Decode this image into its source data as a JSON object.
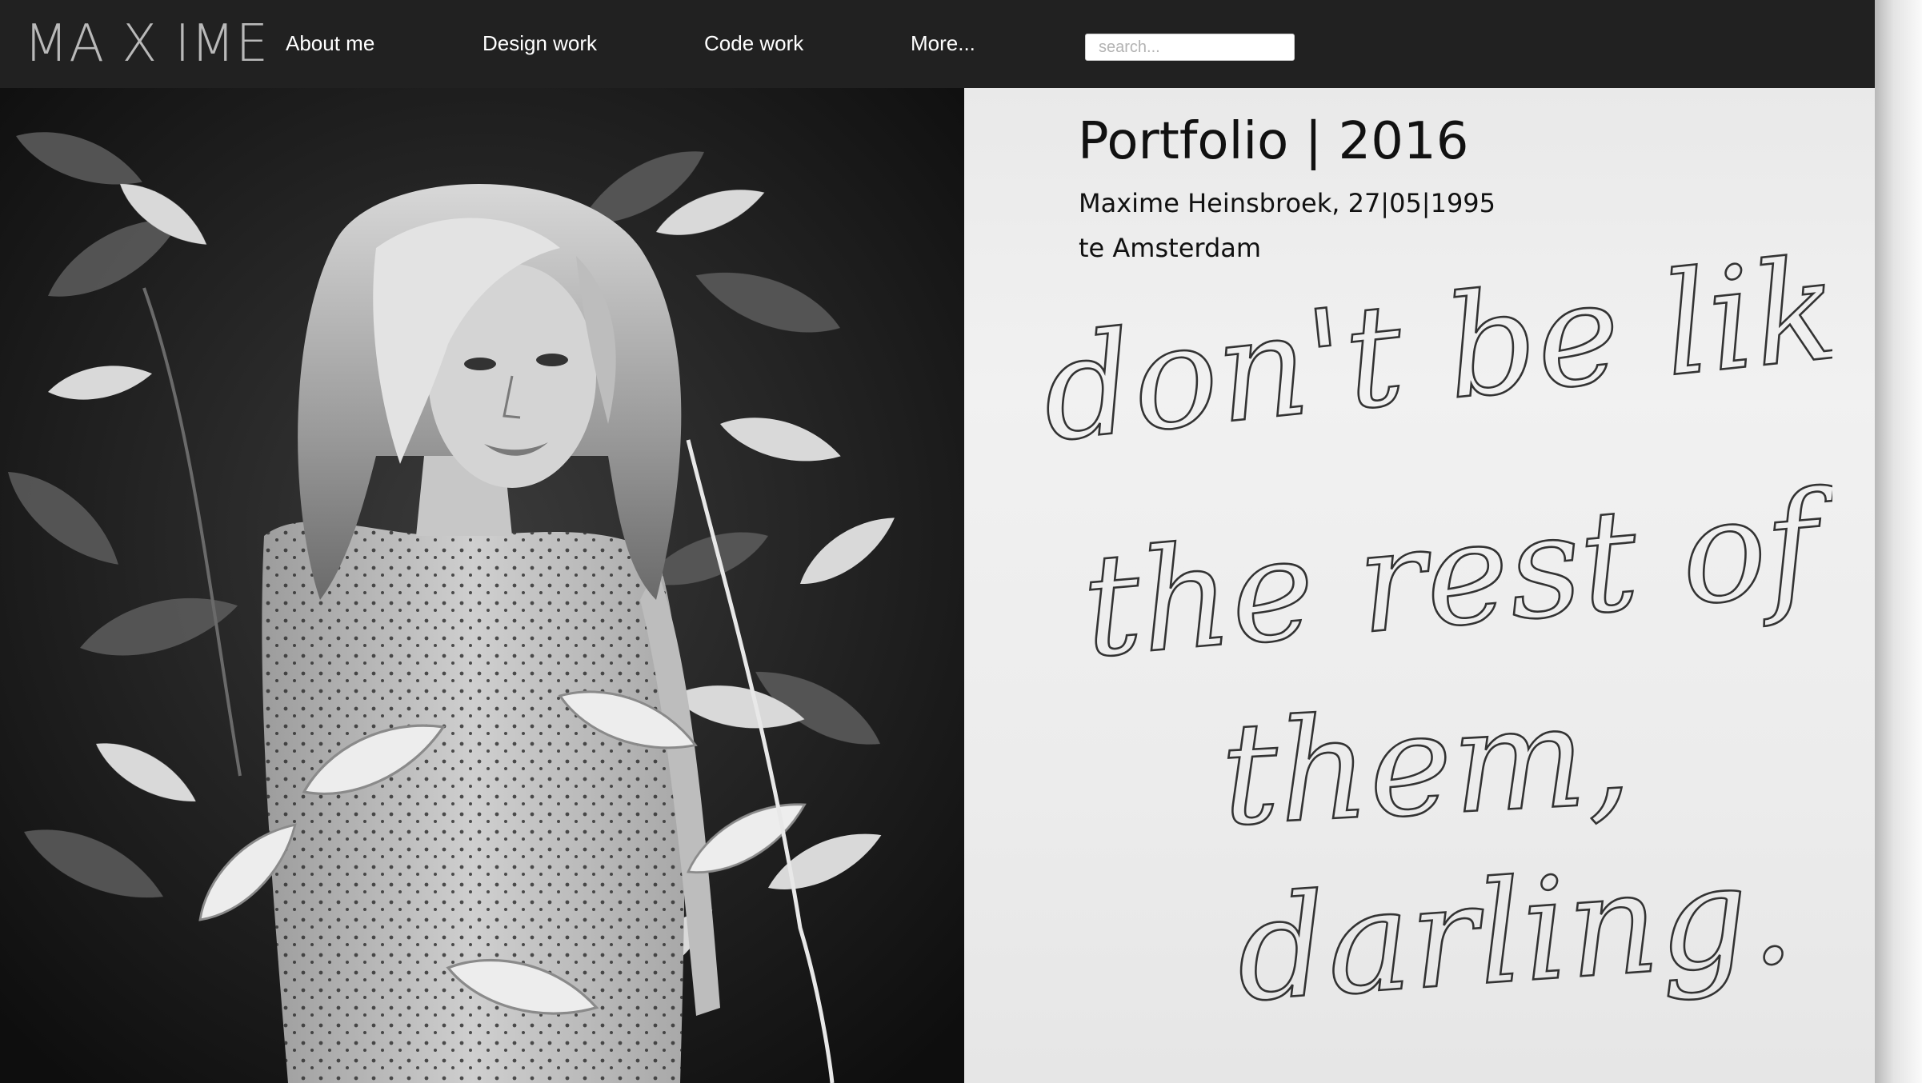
{
  "header": {
    "logo": "MA X IME",
    "nav": [
      {
        "label": "About me"
      },
      {
        "label": "Design work"
      },
      {
        "label": "Code work"
      },
      {
        "label": "More..."
      }
    ],
    "search": {
      "placeholder": "search...",
      "value": ""
    }
  },
  "intro": {
    "title": "Portfolio | 2016",
    "line1": "Maxime Heinsbroek, 27|05|1995",
    "line2": "te Amsterdam"
  },
  "quote": {
    "line1": "don't be like",
    "line2": "the rest of",
    "line3": "them,",
    "line4": "darling."
  },
  "colors": {
    "navbar": "#212121",
    "nav_text": "#ffffff",
    "logo": "#b9b9b9",
    "paper": "#ececec",
    "text": "#111111"
  }
}
